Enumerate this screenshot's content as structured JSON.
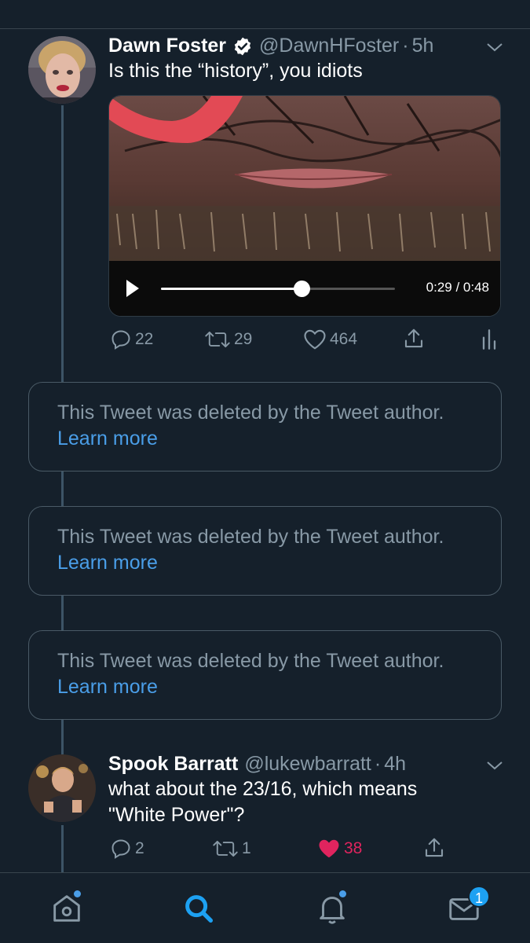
{
  "tweet1": {
    "display_name": "Dawn Foster",
    "handle": "@DawnHFoster",
    "separator": "·",
    "time": "5h",
    "text": "Is this the “history”, you idiots",
    "video": {
      "time_label": "0:29 / 0:48",
      "progress": 0.6
    },
    "actions": {
      "replies": "22",
      "retweets": "29",
      "likes": "464"
    }
  },
  "deleted_tweets": [
    {
      "message": "This Tweet was deleted by the Tweet author.",
      "link": "Learn more"
    },
    {
      "message": "This Tweet was deleted by the Tweet author.",
      "link": "Learn more"
    },
    {
      "message": "This Tweet was deleted by the Tweet author.",
      "link": "Learn more"
    }
  ],
  "tweet2": {
    "display_name": "Spook Barratt",
    "handle": "@lukewbarratt",
    "separator": "·",
    "time": "4h",
    "text_line1": "what about the 23/16, which means",
    "text_line2": "\"White Power\"?",
    "actions": {
      "replies": "2",
      "retweets": "1",
      "likes": "38"
    }
  },
  "bottom_nav": {
    "messages_badge": "1",
    "active": "search"
  },
  "colors": {
    "background": "#15202b",
    "accent": "#1da1f2",
    "muted": "#8899a6",
    "like": "#e0245e",
    "link": "#4a9ee8"
  }
}
